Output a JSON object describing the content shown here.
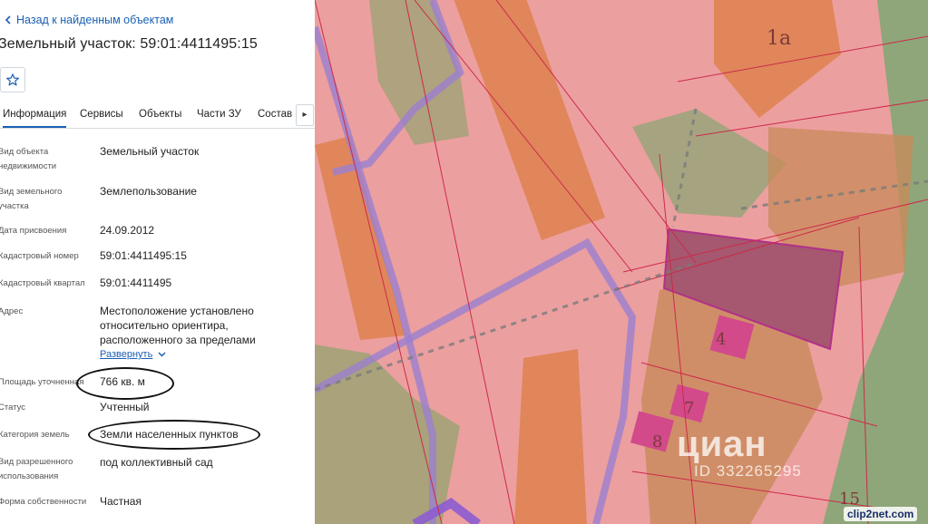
{
  "panel": {
    "back_label": "Назад к найденным объектам",
    "title": "Земельный участок: 59:01:4411495:15",
    "tabs": [
      "Информация",
      "Сервисы",
      "Объекты",
      "Части ЗУ",
      "Состав"
    ],
    "active_tab": "Информация",
    "fields": [
      {
        "label": "Вид объекта недвижимости",
        "value": "Земельный участок"
      },
      {
        "label": "Вид земельного участка",
        "value": "Землепользование"
      },
      {
        "label": "Дата присвоения",
        "value": "24.09.2012"
      },
      {
        "label": "Кадастровый номер",
        "value": "59:01:4411495:15"
      },
      {
        "label": "Кадастровый квартал",
        "value": "59:01:4411495"
      },
      {
        "label": "Адрес",
        "value": "Местоположение установлено относительно ориентира, расположенного за пределами"
      },
      {
        "label": "Площадь уточненная",
        "value": "766 кв. м"
      },
      {
        "label": "Статус",
        "value": "Учтенный"
      },
      {
        "label": "Категория земель",
        "value": "Земли населенных пунктов"
      },
      {
        "label": "Вид разрешенного использования",
        "value": "под коллективный сад"
      },
      {
        "label": "Форма собственности",
        "value": "Частная"
      }
    ],
    "expand_label": "Развернуть"
  },
  "map": {
    "labels": [
      "1а",
      "4",
      "7",
      "8",
      "15"
    ],
    "watermark": "циан",
    "watermark_id": "ID 332265295",
    "source_logo": "clip2net.com"
  },
  "colors": {
    "link": "#1a5fb4",
    "parcel_pink": "#ec9f9f",
    "building_orange": "#e0865a",
    "green_zone": "#8fa67a",
    "selected_parcel": "#b0477a",
    "boundary_purple": "#9b7fcf"
  },
  "icons": {
    "back": "chevron-left-icon",
    "favorite": "star-outline-icon",
    "expand": "chevron-down-icon",
    "tabs_next": "chevron-right-icon"
  }
}
